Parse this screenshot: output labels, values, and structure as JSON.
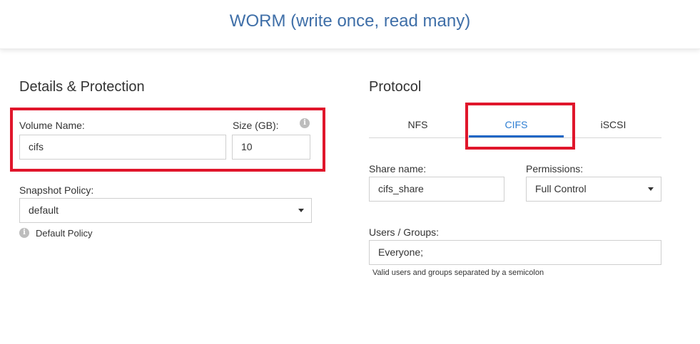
{
  "page": {
    "title": "WORM (write once, read many)"
  },
  "details": {
    "title": "Details & Protection",
    "volume_name_label": "Volume Name:",
    "volume_name_value": "cifs",
    "size_label": "Size (GB):",
    "size_value": "10",
    "snapshot_policy_label": "Snapshot Policy:",
    "snapshot_policy_value": "default",
    "snapshot_policy_hint": "Default Policy"
  },
  "protocol": {
    "title": "Protocol",
    "tabs": [
      {
        "label": "NFS",
        "active": false
      },
      {
        "label": "CIFS",
        "active": true
      },
      {
        "label": "iSCSI",
        "active": false
      }
    ],
    "share_name_label": "Share name:",
    "share_name_value": "cifs_share",
    "permissions_label": "Permissions:",
    "permissions_value": "Full Control",
    "users_groups_label": "Users / Groups:",
    "users_groups_value": "Everyone;",
    "users_groups_hint": "Valid users and groups separated by a semicolon"
  },
  "colors": {
    "title_blue": "#3f6fa8",
    "active_tab": "#2f7fd3",
    "highlight_red": "#e0162b"
  },
  "icons": {
    "info": "info-icon",
    "dropdown": "chevron-down-icon"
  }
}
